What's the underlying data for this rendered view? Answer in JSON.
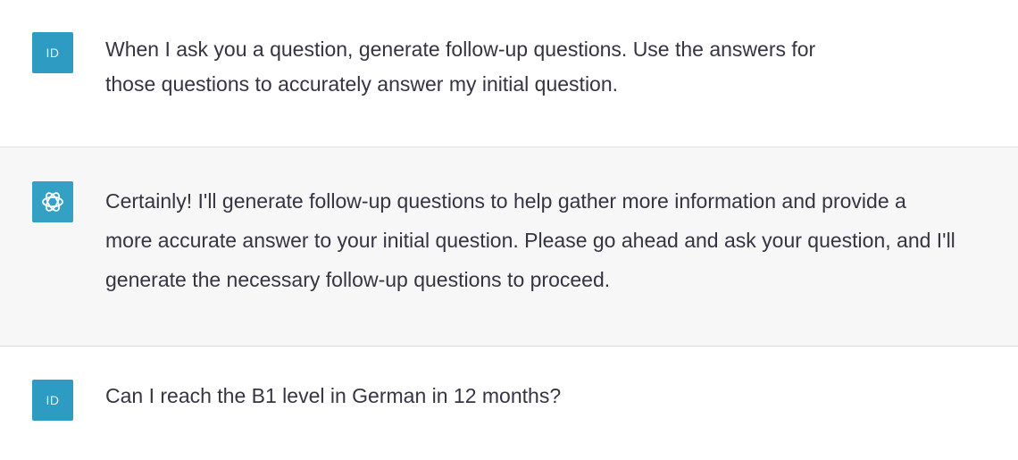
{
  "messages": [
    {
      "role": "user",
      "avatar_text": "ID",
      "lines": [
        "When I ask you a question, generate follow-up questions. Use the answers for",
        "those questions to accurately answer my initial question."
      ]
    },
    {
      "role": "assistant",
      "avatar_icon": "openai-logo-icon",
      "lines": [
        "Certainly! I'll generate follow-up questions to help gather more information and provide a",
        "more accurate answer to your initial question. Please go ahead and ask your question, and I'll",
        "generate the necessary follow-up questions to proceed."
      ]
    },
    {
      "role": "user",
      "avatar_text": "ID",
      "lines": [
        "Can I reach the B1 level in German in 12 months?"
      ]
    }
  ],
  "colors": {
    "user_avatar_bg": "#2d9bc2",
    "assistant_avatar_bg": "#34a1c4",
    "assistant_row_bg": "#f7f7f8",
    "text": "#343541"
  }
}
